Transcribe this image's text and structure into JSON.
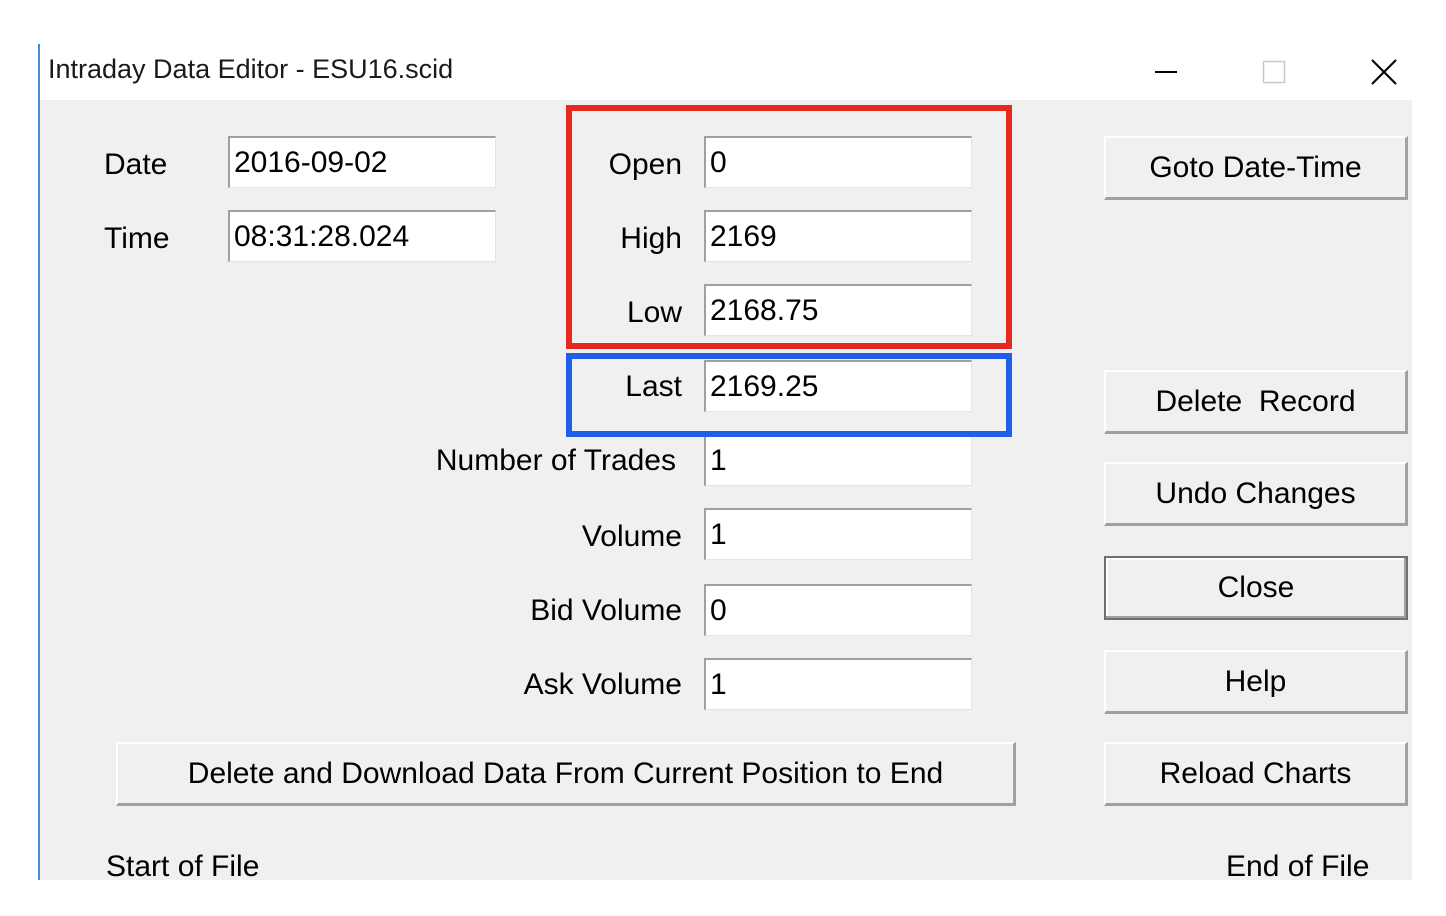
{
  "window": {
    "title": "Intraday Data Editor - ESU16.scid",
    "controls": [
      "minimize-icon",
      "maximize-icon",
      "close-icon"
    ]
  },
  "labels": {
    "date": "Date",
    "time": "Time",
    "open": "Open",
    "high": "High",
    "low": "Low",
    "last": "Last",
    "num_trades": "Number of Trades",
    "volume": "Volume",
    "bid_volume": "Bid Volume",
    "ask_volume": "Ask Volume",
    "start_of_file": "Start of File",
    "end_of_file": "End of File"
  },
  "fields": {
    "date": "2016-09-02",
    "time": "08:31:28.024",
    "open": "0",
    "high": "2169",
    "low": "2168.75",
    "last": "2169.25",
    "num_trades": "1",
    "volume": "1",
    "bid_volume": "0",
    "ask_volume": "1"
  },
  "buttons": {
    "goto": "Goto Date-Time",
    "delete_record": "Delete  Record",
    "undo": "Undo Changes",
    "close": "Close",
    "help": "Help",
    "reload": "Reload Charts",
    "delete_download": "Delete and Download Data From Current Position to End"
  },
  "highlights": {
    "ohl_color": "#e8281e",
    "last_color": "#1e5ee8"
  }
}
